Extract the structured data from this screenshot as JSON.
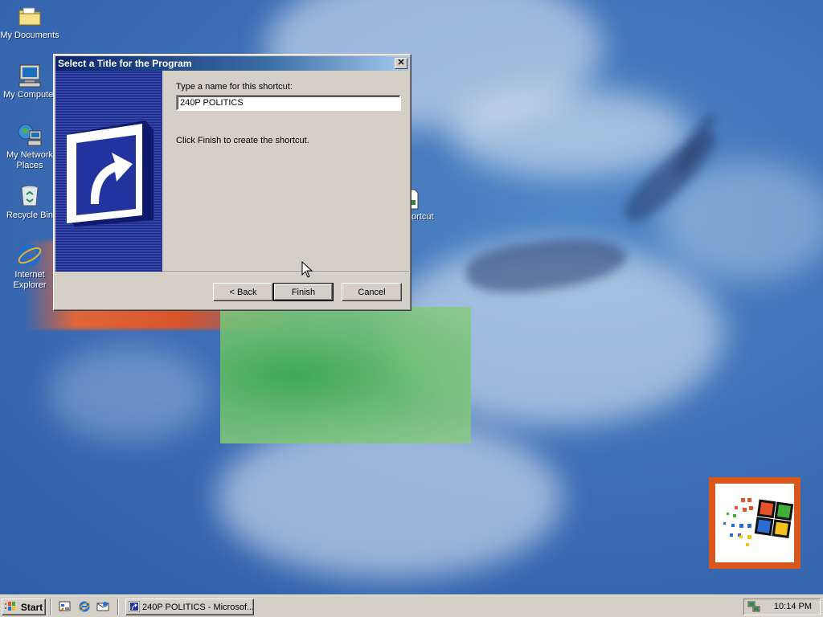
{
  "desktop": {
    "icons": [
      {
        "label": "My Documents"
      },
      {
        "label": "My Computer"
      },
      {
        "label": "My Network Places"
      },
      {
        "label": "Recycle Bin"
      },
      {
        "label": "Internet Explorer"
      }
    ],
    "partial_shortcut_label": "ortcut"
  },
  "dialog": {
    "title": "Select a Title for the Program",
    "close_glyph": "✕",
    "prompt": "Type a name for this shortcut:",
    "name_value": "240P POLITICS",
    "info": "Click Finish to create the shortcut.",
    "buttons": {
      "back": "< Back",
      "finish": "Finish",
      "cancel": "Cancel"
    }
  },
  "taskbar": {
    "start_label": "Start",
    "quick_launch": [
      "show-desktop-icon",
      "internet-explorer-icon",
      "outlook-express-icon"
    ],
    "task_item": "240P POLITICS - Microsof...",
    "clock": "10:14 PM",
    "tray_icon": "network-tray-icon"
  },
  "colors": {
    "desktop": "#3b6cb4",
    "titlebar_start": "#0a246a",
    "titlebar_end": "#a6caf0",
    "face": "#d4d0c8",
    "logo_frame": "#d8581c"
  }
}
